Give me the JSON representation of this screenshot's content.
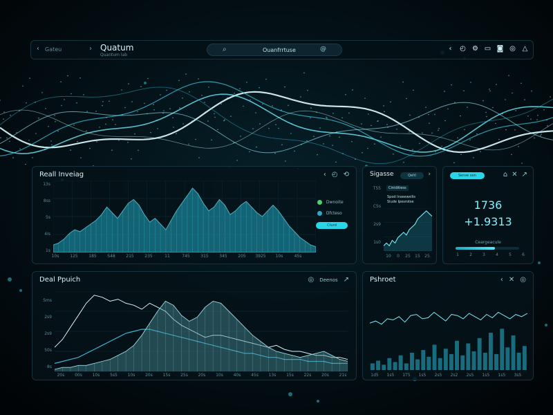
{
  "header": {
    "back_icon": "chevron-left-icon",
    "nav_label": "Gateu",
    "forward_icon": "chevron-right-icon",
    "brand": "Quatum",
    "brand_sub": "Quantum lab",
    "search_icon": "search-icon",
    "search_text": "Ouanfrrtuse",
    "search_action_icon": "at-icon",
    "tool_icons": [
      {
        "name": "chevron-left-icon",
        "glyph": "‹"
      },
      {
        "name": "clock-icon",
        "glyph": "◴"
      },
      {
        "name": "settings-icon",
        "glyph": "⚙"
      },
      {
        "name": "message-icon",
        "glyph": "▭"
      },
      {
        "name": "camera-icon",
        "glyph": "◙"
      },
      {
        "name": "globe-icon",
        "glyph": "◎"
      },
      {
        "name": "alert-icon",
        "glyph": "△"
      }
    ]
  },
  "panel1": {
    "title": "Reall Inveiag",
    "tools": [
      "‹",
      "◴",
      "⟲"
    ],
    "y_ticks": [
      "13s",
      "8ss",
      "5s",
      "4Is",
      "1s"
    ],
    "x_ticks": [
      "10s",
      "125",
      "185",
      "S48",
      "215",
      "235",
      "11",
      "745",
      "315",
      "345",
      "205",
      "3925",
      "10s",
      "45s"
    ],
    "legend": [
      "Dwnoite",
      "Dfcteso"
    ],
    "legend_colors": [
      "#49d36a",
      "#2aa8c6"
    ],
    "legend_pill": "Cturd"
  },
  "panel2": {
    "title": "Sigasse",
    "tab": "Qeltl",
    "y_ticks": [
      "T55",
      "C5s",
      "2s9",
      "1s0"
    ],
    "chip_a": "Ciniditiess",
    "chip_b": "Spod Inseewsilis\nSlude Ipesrotse",
    "x_ticks": [
      "10",
      "0",
      "25",
      "15",
      "25"
    ],
    "arrow_icon": "arrow-right-icon"
  },
  "panel3": {
    "pill": "Sense oon",
    "big_a": "1736",
    "big_b": "+1.9313",
    "bar_label": "Ceargeacule",
    "bar_value": 0.62,
    "ticks": [
      "1",
      "2",
      "3",
      "4",
      "5",
      "6"
    ],
    "tools": [
      "⌂",
      "✕",
      "↗"
    ]
  },
  "panel4": {
    "title": "Deal Ppuich",
    "tools": [
      "◎",
      "Deenos",
      "↗"
    ],
    "y_ticks": [
      "5ms",
      "2s9",
      "2s9",
      "50s",
      "8s"
    ],
    "x_ticks": [
      "20s",
      "00s",
      "10s",
      "5s5",
      "10s",
      "20s",
      "15s",
      "25s",
      "20s",
      "10s",
      "40s",
      "45s",
      "13s",
      "15s",
      "22s",
      "20s",
      "21s"
    ]
  },
  "panel5": {
    "title": "Pshroet",
    "tools": [
      "‹",
      "✕",
      "◎"
    ],
    "x_ticks": [
      "1d5",
      "1s5",
      "1T5",
      "1s5",
      "2s5",
      "2s2",
      "2s5",
      "1s5",
      "1s5",
      "3s5"
    ]
  },
  "chart_data": [
    {
      "type": "area",
      "title": "Reall Inveiag",
      "x": [
        0,
        1,
        2,
        3,
        4,
        5,
        6,
        7,
        8,
        9,
        10,
        11,
        12,
        13,
        14,
        15,
        16,
        17,
        18,
        19,
        20,
        21,
        22,
        23,
        24,
        25,
        26,
        27,
        28,
        29,
        30,
        31,
        32,
        33,
        34,
        35,
        36,
        37,
        38,
        39,
        40,
        41,
        42,
        43,
        44,
        45,
        46,
        47,
        48,
        49
      ],
      "values": [
        4,
        5,
        7,
        10,
        12,
        11,
        13,
        15,
        17,
        20,
        24,
        21,
        18,
        22,
        26,
        28,
        25,
        20,
        16,
        18,
        15,
        12,
        17,
        22,
        26,
        30,
        34,
        31,
        26,
        22,
        24,
        28,
        25,
        20,
        22,
        25,
        27,
        24,
        21,
        19,
        22,
        25,
        22,
        18,
        14,
        11,
        8,
        6,
        4,
        3
      ],
      "ylim": [
        0,
        38
      ]
    },
    {
      "type": "line",
      "title": "Sigasse",
      "values": [
        2,
        3,
        2,
        4,
        3,
        5,
        6,
        7,
        6,
        8,
        9,
        10,
        12,
        13,
        14,
        15,
        14,
        13
      ],
      "ylim": [
        0,
        16
      ]
    },
    {
      "type": "line",
      "title": "Deal Ppuich",
      "series": [
        {
          "values": [
            12,
            16,
            22,
            28,
            34,
            38,
            37,
            35,
            36,
            34,
            33,
            31,
            34,
            32,
            30,
            26,
            23,
            21,
            19,
            17,
            18,
            18,
            17,
            16,
            15,
            14,
            13,
            12,
            13,
            11,
            10,
            10,
            9,
            8,
            8,
            7,
            7,
            6
          ]
        },
        {
          "values": [
            4,
            5,
            6,
            7,
            9,
            11,
            13,
            15,
            17,
            19,
            20,
            21,
            21,
            20,
            19,
            18,
            17,
            16,
            15,
            14,
            13,
            12,
            11,
            10,
            9,
            9,
            8,
            7,
            7,
            6,
            6,
            6,
            5,
            5,
            5,
            4,
            4,
            4
          ]
        },
        {
          "values": [
            1,
            2,
            2,
            3,
            3,
            4,
            5,
            6,
            8,
            10,
            13,
            18,
            24,
            30,
            35,
            33,
            28,
            25,
            27,
            32,
            35,
            34,
            30,
            26,
            22,
            18,
            15,
            12,
            10,
            9,
            8,
            7,
            8,
            9,
            10,
            8,
            6,
            5
          ]
        }
      ],
      "ylim": [
        0,
        40
      ]
    },
    {
      "type": "bar",
      "title": "Pshroet",
      "values": [
        5,
        7,
        4,
        9,
        6,
        11,
        5,
        13,
        8,
        15,
        10,
        19,
        9,
        16,
        12,
        22,
        11,
        20,
        14,
        24,
        13,
        28,
        12,
        31,
        17,
        26,
        13,
        18
      ],
      "line_values": [
        16,
        18,
        15,
        20,
        19,
        22,
        17,
        23,
        24,
        20,
        21,
        26,
        22,
        18,
        24,
        23,
        20,
        25,
        22,
        19,
        24,
        21,
        26,
        23,
        20,
        24,
        22,
        25
      ],
      "ylim": [
        0,
        32
      ]
    }
  ]
}
